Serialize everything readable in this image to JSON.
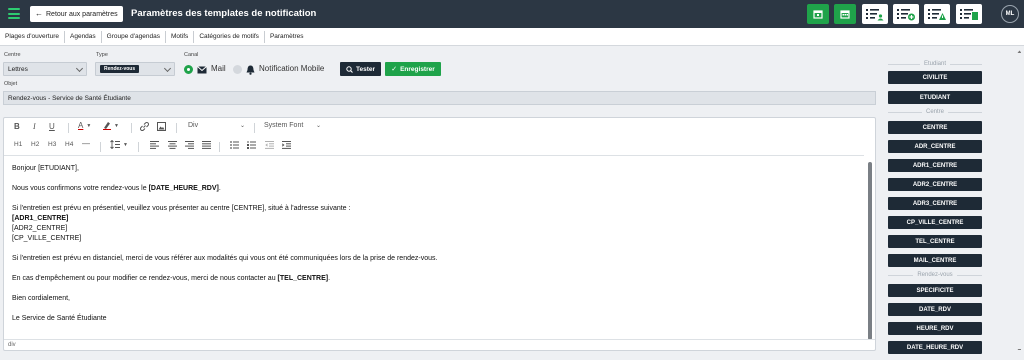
{
  "header": {
    "back_label": "Retour aux paramètres",
    "title": "Paramètres des templates de notification",
    "toolbar_icons": [
      "calendar-icon",
      "calendar-grid-icon",
      "list-user-icon",
      "list-add-icon",
      "list-warning-icon",
      "list-document-icon"
    ],
    "avatar_initials": "ML",
    "colors": {
      "bar": "#2c3744",
      "accent": "#1fa34a"
    }
  },
  "tabs": [
    {
      "label": "Plages d'ouverture"
    },
    {
      "label": "Agendas"
    },
    {
      "label": "Groupe d'agendas"
    },
    {
      "label": "Motifs"
    },
    {
      "label": "Catégories de motifs"
    },
    {
      "label": "Paramètres"
    }
  ],
  "form": {
    "centre_label": "Centre",
    "centre_value": "Lettres",
    "type_label": "Type",
    "type_value": "Rendez-vous",
    "canal_label": "Canal",
    "canal_mail": "Mail",
    "canal_notification": "Notification Mobile",
    "tester_label": "Tester",
    "enregistrer_label": "Enregistrer",
    "objet_label": "Objet",
    "objet_value": "Rendez-vous - Service de Santé Étudiante"
  },
  "editor": {
    "format_value": "Div",
    "font_value": "System Font",
    "headings": [
      "H1",
      "H2",
      "H3",
      "H4"
    ],
    "status_path": "div",
    "body": {
      "greeting": "Bonjour [ETUDIANT],",
      "line1_prefix": "Nous vous confirmons votre rendez-vous le ",
      "line1_bold": "[DATE_HEURE_RDV]",
      "line1_suffix": ".",
      "line2": "Si l'entretien est prévu en présentiel, veuillez vous présenter au centre [CENTRE], situé à l'adresse suivante :",
      "addr1": "[ADR1_CENTRE]",
      "addr2": "[ADR2_CENTRE]",
      "addr3": "[CP_VILLE_CENTRE]",
      "line3": "Si l'entretien est prévu en distanciel, merci de vous référer aux modalités qui vous ont été communiquées lors de la prise de rendez-vous.",
      "line4_prefix": "En cas d'empêchement ou pour modifier ce rendez-vous, merci de nous contacter au ",
      "line4_bold": "[TEL_CENTRE]",
      "line4_suffix": ".",
      "closing": "Bien cordialement,",
      "signature": "Le Service de Santé Étudiante"
    }
  },
  "variables": {
    "etudiant_heading": "Etudiant",
    "etudiant": [
      "CIVILITE",
      "ETUDIANT"
    ],
    "centre_heading": "Centre",
    "centre": [
      "CENTRE",
      "ADR_CENTRE",
      "ADR1_CENTRE",
      "ADR2_CENTRE",
      "ADR3_CENTRE",
      "CP_VILLE_CENTRE",
      "TEL_CENTRE",
      "MAIL_CENTRE"
    ],
    "rdv_heading": "Rendez-vous",
    "rdv": [
      "SPECIFICITE",
      "DATE_RDV",
      "HEURE_RDV",
      "DATE_HEURE_RDV"
    ]
  }
}
